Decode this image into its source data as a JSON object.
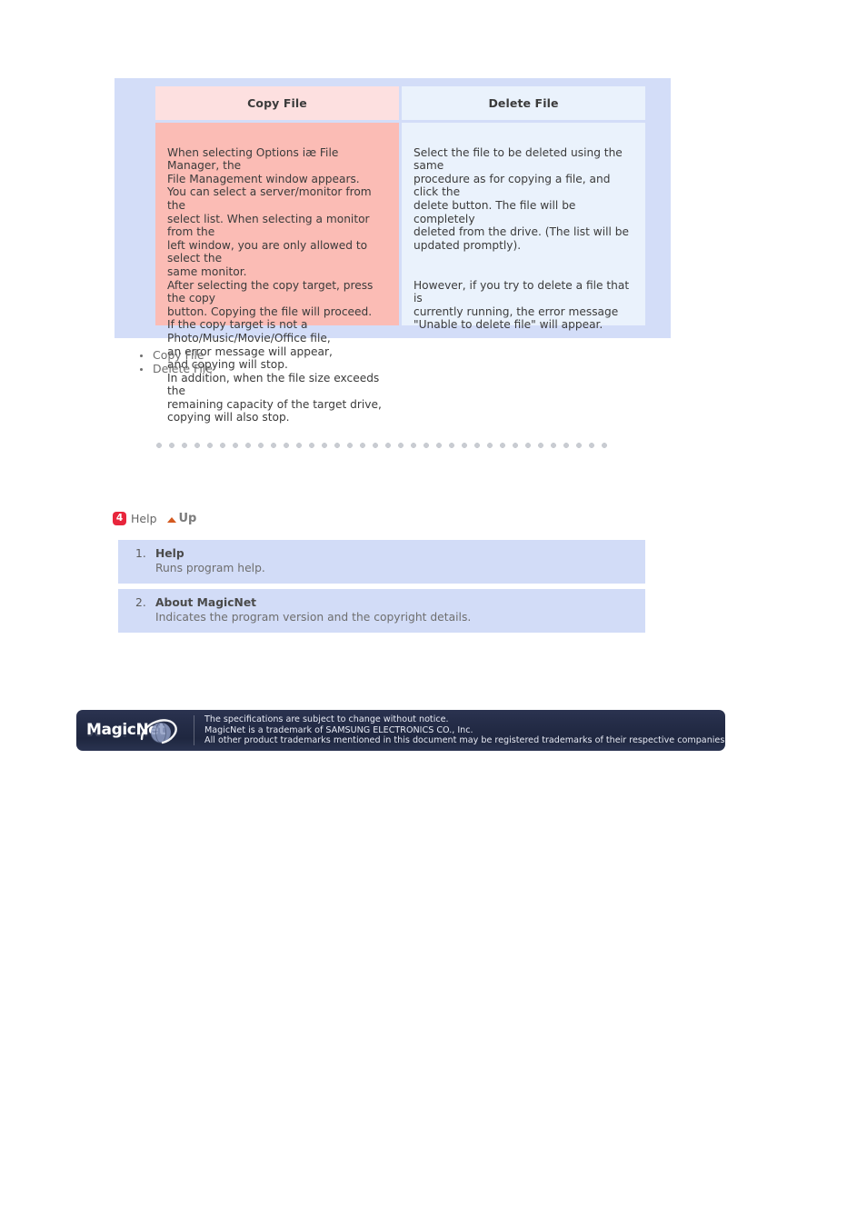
{
  "comparison_table": {
    "columns": [
      {
        "header": "Copy File",
        "paragraphs": [
          "When selecting Options iæ File Manager, the\nFile Management window appears.\nYou can select a server/monitor from the\nselect list. When selecting a monitor from the\nleft window, you are only allowed to select the\nsame monitor.\nAfter selecting the copy target, press the copy\nbutton. Copying the file will proceed.\nIf the copy target is not a\nPhoto/Music/Movie/Office file,\nan error message will appear,\nand copying will stop.\nIn addition, when the file size exceeds the\nremaining capacity of the target drive,\ncopying will also stop."
        ]
      },
      {
        "header": "Delete File",
        "paragraphs": [
          "Select the file to be deleted using the same\nprocedure as for copying a file, and click the\ndelete button. The file will be completely\ndeleted from the drive. (The list will be\nupdated promptly).",
          "However, if you try to delete a file that is\ncurrently running, the error message\n\"Unable to delete file\" will appear."
        ]
      }
    ]
  },
  "bullet_list": [
    "Copy File",
    "Delete File"
  ],
  "section": {
    "badge_number": "4",
    "title": "Help",
    "up_label": "Up"
  },
  "items": [
    {
      "number": "1.",
      "title": "Help",
      "description": "Runs program help."
    },
    {
      "number": "2.",
      "title": "About MagicNet",
      "description": "Indicates the program version and the copyright details."
    }
  ],
  "footer": {
    "logo_text": "MagicNet",
    "lines": [
      "The specifications are subject to change without notice.",
      "MagicNet is a trademark of SAMSUNG ELECTRONICS CO., Inc.",
      "All other product trademarks mentioned in this document may be registered trademarks of their respective companies."
    ]
  },
  "colors": {
    "panel_bg": "#d3ddf8",
    "copy_header_bg": "#fde0e0",
    "copy_body_bg": "#fbbcb5",
    "delete_cell_bg": "#eaf2fc",
    "item_block_bg": "#d2dcf7",
    "badge_red": "#e8263c",
    "up_arrow": "#d4591f",
    "footer_navy": "#242c47"
  }
}
